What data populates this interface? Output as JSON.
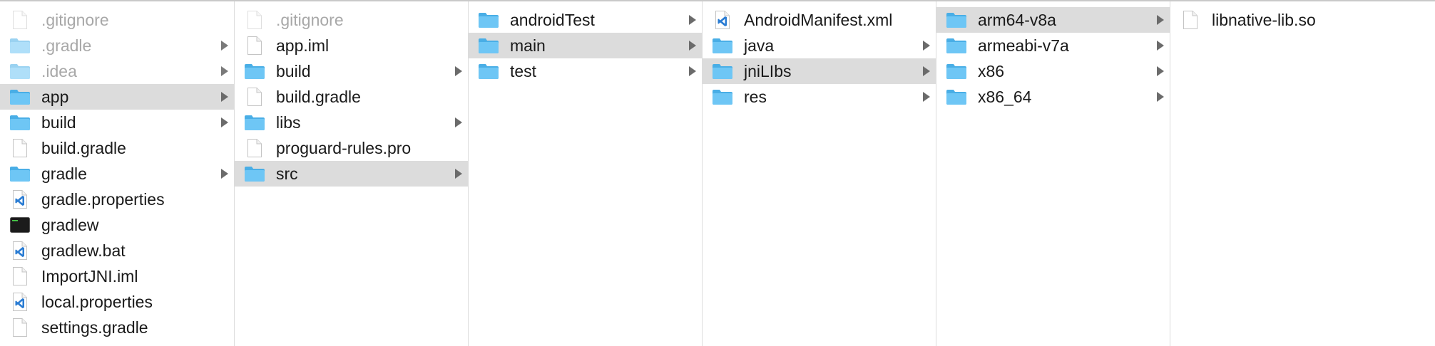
{
  "columns": [
    {
      "items": [
        {
          "name": ".gitignore",
          "kind": "doc",
          "hidden": true,
          "folder": false,
          "selected": false
        },
        {
          "name": ".gradle",
          "kind": "folder",
          "hidden": true,
          "folder": true,
          "selected": false
        },
        {
          "name": ".idea",
          "kind": "folder",
          "hidden": true,
          "folder": true,
          "selected": false
        },
        {
          "name": "app",
          "kind": "folder",
          "hidden": false,
          "folder": true,
          "selected": true
        },
        {
          "name": "build",
          "kind": "folder",
          "hidden": false,
          "folder": true,
          "selected": false
        },
        {
          "name": "build.gradle",
          "kind": "doc",
          "hidden": false,
          "folder": false,
          "selected": false
        },
        {
          "name": "gradle",
          "kind": "folder",
          "hidden": false,
          "folder": true,
          "selected": false
        },
        {
          "name": "gradle.properties",
          "kind": "vscode",
          "hidden": false,
          "folder": false,
          "selected": false
        },
        {
          "name": "gradlew",
          "kind": "terminal",
          "hidden": false,
          "folder": false,
          "selected": false
        },
        {
          "name": "gradlew.bat",
          "kind": "vscode",
          "hidden": false,
          "folder": false,
          "selected": false
        },
        {
          "name": "ImportJNI.iml",
          "kind": "doc",
          "hidden": false,
          "folder": false,
          "selected": false
        },
        {
          "name": "local.properties",
          "kind": "vscode",
          "hidden": false,
          "folder": false,
          "selected": false
        },
        {
          "name": "settings.gradle",
          "kind": "doc",
          "hidden": false,
          "folder": false,
          "selected": false
        }
      ]
    },
    {
      "items": [
        {
          "name": ".gitignore",
          "kind": "doc",
          "hidden": true,
          "folder": false,
          "selected": false
        },
        {
          "name": "app.iml",
          "kind": "doc",
          "hidden": false,
          "folder": false,
          "selected": false
        },
        {
          "name": "build",
          "kind": "folder",
          "hidden": false,
          "folder": true,
          "selected": false
        },
        {
          "name": "build.gradle",
          "kind": "doc",
          "hidden": false,
          "folder": false,
          "selected": false
        },
        {
          "name": "libs",
          "kind": "folder",
          "hidden": false,
          "folder": true,
          "selected": false
        },
        {
          "name": "proguard-rules.pro",
          "kind": "doc",
          "hidden": false,
          "folder": false,
          "selected": false
        },
        {
          "name": "src",
          "kind": "folder",
          "hidden": false,
          "folder": true,
          "selected": true
        }
      ]
    },
    {
      "items": [
        {
          "name": "androidTest",
          "kind": "folder",
          "hidden": false,
          "folder": true,
          "selected": false
        },
        {
          "name": "main",
          "kind": "folder",
          "hidden": false,
          "folder": true,
          "selected": true
        },
        {
          "name": "test",
          "kind": "folder",
          "hidden": false,
          "folder": true,
          "selected": false
        }
      ]
    },
    {
      "items": [
        {
          "name": "AndroidManifest.xml",
          "kind": "vscode",
          "hidden": false,
          "folder": false,
          "selected": false
        },
        {
          "name": "java",
          "kind": "folder",
          "hidden": false,
          "folder": true,
          "selected": false
        },
        {
          "name": "jniLIbs",
          "kind": "folder",
          "hidden": false,
          "folder": true,
          "selected": true
        },
        {
          "name": "res",
          "kind": "folder",
          "hidden": false,
          "folder": true,
          "selected": false
        }
      ]
    },
    {
      "items": [
        {
          "name": "arm64-v8a",
          "kind": "folder",
          "hidden": false,
          "folder": true,
          "selected": true
        },
        {
          "name": "armeabi-v7a",
          "kind": "folder",
          "hidden": false,
          "folder": true,
          "selected": false
        },
        {
          "name": "x86",
          "kind": "folder",
          "hidden": false,
          "folder": true,
          "selected": false
        },
        {
          "name": "x86_64",
          "kind": "folder",
          "hidden": false,
          "folder": true,
          "selected": false
        }
      ]
    },
    {
      "items": [
        {
          "name": "libnative-lib.so",
          "kind": "doc",
          "hidden": false,
          "folder": false,
          "selected": false
        }
      ]
    }
  ],
  "colors": {
    "folder_blue": "#6ec6f5",
    "folder_blue_dark": "#49aee6",
    "selected_row": "#dcdcdc",
    "vscode_blue": "#2a7cd3"
  }
}
